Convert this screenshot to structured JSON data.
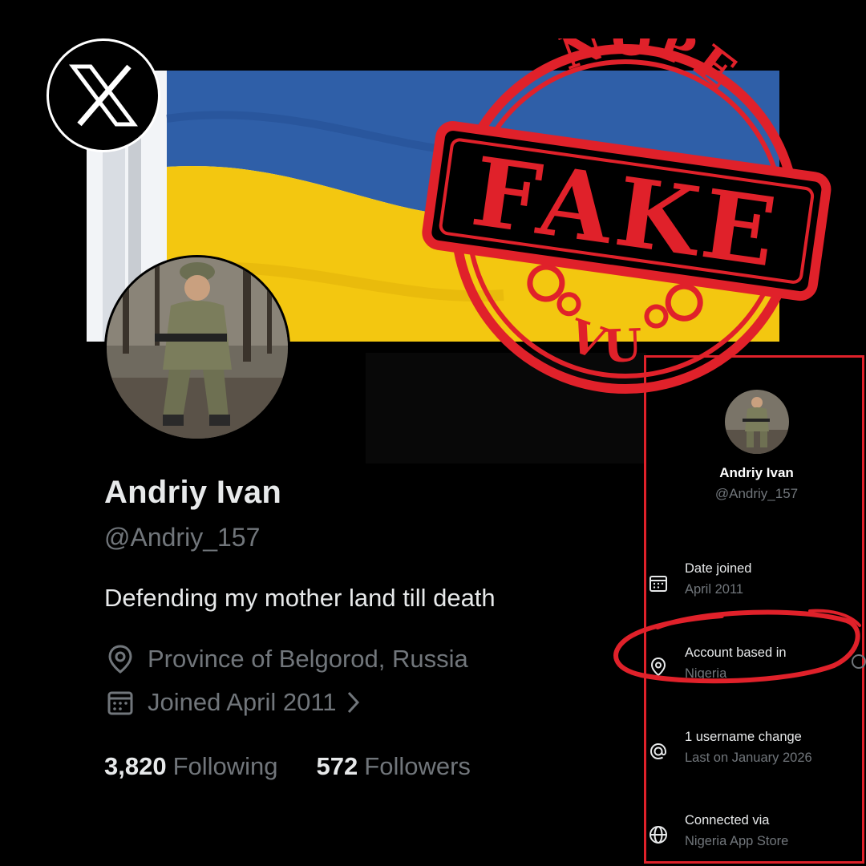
{
  "brand_logo": "x-logo",
  "profile": {
    "name": "Andriy Ivan",
    "handle": "@Andriy_157",
    "bio": "Defending my mother land till death",
    "location": "Province of Belgorod, Russia",
    "joined": "Joined April 2011",
    "following_count": "3,820",
    "following_label": "Following",
    "followers_count": "572",
    "followers_label": "Followers"
  },
  "about_panel": {
    "name": "Andriy Ivan",
    "handle": "@Andriy_157",
    "items": [
      {
        "icon": "calendar-icon",
        "title": "Date joined",
        "value": "April 2011"
      },
      {
        "icon": "location-pin-icon",
        "title": "Account based in",
        "value": "Nigeria"
      },
      {
        "icon": "at-sign-icon",
        "title": "1 username change",
        "value": "Last on January 2026"
      },
      {
        "icon": "globe-icon",
        "title": "Connected via",
        "value": "Nigeria App Store"
      }
    ]
  },
  "stamp": {
    "top": "NOPE",
    "main": "FAKE",
    "bottom": "VU"
  },
  "colors": {
    "background": "#000000",
    "text": "#e7e9ea",
    "muted": "#71767b",
    "stamp_red": "#e0212a",
    "flag_blue": "#2f5fa8",
    "flag_yellow": "#f3c710"
  }
}
